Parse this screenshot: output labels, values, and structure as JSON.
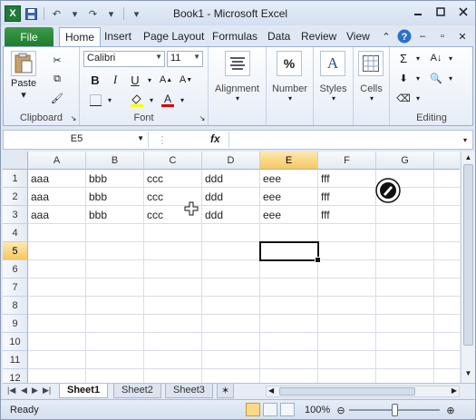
{
  "window": {
    "title": "Book1 - Microsoft Excel",
    "app_icon": "X",
    "controls": [
      "minimize-icon",
      "restore-icon",
      "close-icon"
    ]
  },
  "qat": {
    "save": "save-icon",
    "undo": "↶",
    "redo": "↷",
    "more": "▾"
  },
  "ribbon_tabs": [
    "File",
    "Home",
    "Insert",
    "Page Layout",
    "Formulas",
    "Data",
    "Review",
    "View"
  ],
  "active_tab": "Home",
  "ribbon": {
    "clipboard": {
      "label": "Clipboard",
      "paste": "Paste"
    },
    "font": {
      "label": "Font",
      "name": "Calibri",
      "size": "11",
      "bold": "B",
      "italic": "I",
      "underline": "U"
    },
    "alignment": {
      "label": "Alignment"
    },
    "number": {
      "label": "Number",
      "symbol": "%"
    },
    "styles": {
      "label": "Styles",
      "symbol": "A"
    },
    "cells": {
      "label": "Cells"
    },
    "editing": {
      "label": "Editing",
      "sum": "Σ"
    },
    "font_color": "#e00000",
    "fill_color": "#ffff00"
  },
  "formula_bar": {
    "name_box": "E5",
    "fx": "fx",
    "formula": ""
  },
  "columns": [
    "A",
    "B",
    "C",
    "D",
    "E",
    "F",
    "G"
  ],
  "rows": [
    "1",
    "2",
    "3",
    "4",
    "5",
    "6",
    "7",
    "8",
    "9",
    "10",
    "11",
    "12"
  ],
  "cells": [
    [
      "aaa",
      "bbb",
      "ccc",
      "ddd",
      "eee",
      "fff",
      ""
    ],
    [
      "aaa",
      "bbb",
      "ccc",
      "ddd",
      "eee",
      "fff",
      ""
    ],
    [
      "aaa",
      "bbb",
      "ccc",
      "ddd",
      "eee",
      "fff",
      ""
    ]
  ],
  "active_cell": "E5",
  "sheets": [
    "Sheet1",
    "Sheet2",
    "Sheet3"
  ],
  "active_sheet": "Sheet1",
  "status": {
    "ready": "Ready",
    "zoom": "100%"
  }
}
